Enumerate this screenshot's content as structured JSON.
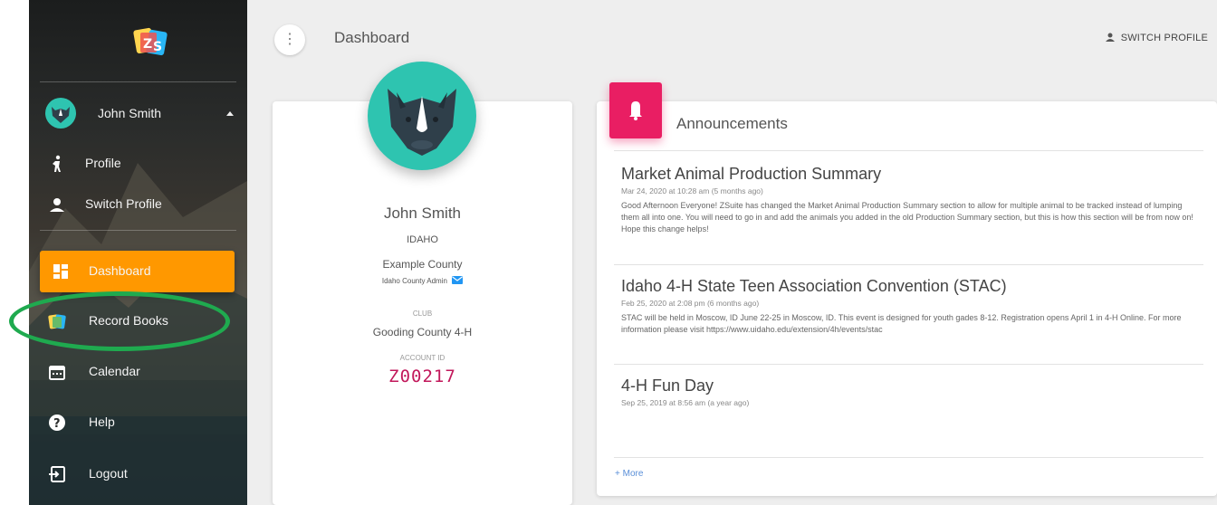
{
  "header": {
    "title": "Dashboard",
    "switch_profile": "SWITCH PROFILE",
    "menu_glyph": "⋮"
  },
  "sidebar": {
    "user_name": "John Smith",
    "items": [
      {
        "label": "Profile",
        "icon": "person-walking-icon"
      },
      {
        "label": "Switch Profile",
        "icon": "person-icon"
      },
      {
        "label": "Dashboard",
        "icon": "dashboard-icon",
        "active": true
      },
      {
        "label": "Record Books",
        "icon": "record-books-icon"
      },
      {
        "label": "Calendar",
        "icon": "calendar-icon"
      },
      {
        "label": "Help",
        "icon": "help-icon"
      },
      {
        "label": "Logout",
        "icon": "logout-icon"
      }
    ]
  },
  "profile": {
    "name": "John Smith",
    "state": "IDAHO",
    "county": "Example County",
    "role": "Idaho County Admin",
    "club_label": "CLUB",
    "club": "Gooding County 4-H",
    "account_label": "ACCOUNT ID",
    "account_id": "Z00217"
  },
  "announcements": {
    "title": "Announcements",
    "items": [
      {
        "title": "Market Animal Production Summary",
        "date": "Mar 24, 2020 at 10:28 am (5 months ago)",
        "body": "Good Afternoon Everyone! ZSuite has changed the Market Animal Production Summary section to allow for multiple animal to be tracked instead of lumping them all into one. You will need to go in and add the animals you added in the old Production Summary section, but this is how this section will be from now on! Hope this change helps!"
      },
      {
        "title": "Idaho 4-H State Teen Association Convention (STAC)",
        "date": "Feb 25, 2020 at 2:08 pm (6 months ago)",
        "body": "STAC will be held in Moscow, ID June 22-25 in Moscow, ID. This event is designed for youth gades 8-12. Registration opens April 1 in 4-H Online. For more information please visit https://www.uidaho.edu/extension/4h/events/stac"
      },
      {
        "title": "4-H Fun Day",
        "date": "Sep 25, 2019 at 8:56 am (a year ago)",
        "body": ""
      }
    ],
    "more_label": "+ More"
  },
  "colors": {
    "accent": "#ff9800",
    "bell": "#e91e63",
    "avatar": "#2ec4b0",
    "account_id": "#c2185b",
    "annotation_ring": "#1faa4f"
  }
}
